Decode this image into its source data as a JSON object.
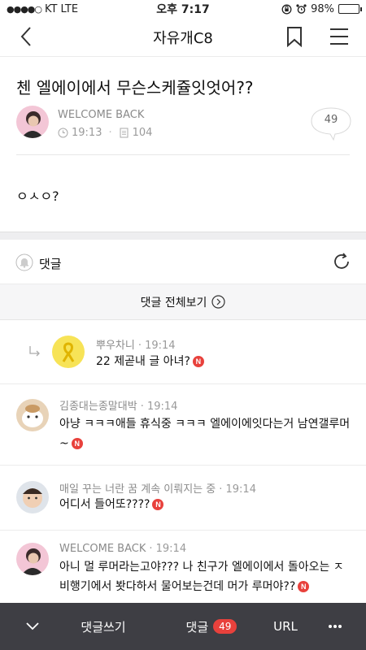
{
  "status_bar": {
    "carrier": "KT",
    "network": "LTE",
    "time": "오후 7:17",
    "battery_percent": "98%",
    "battery_level": 0.98
  },
  "nav": {
    "title": "자유개C8"
  },
  "post": {
    "title": "첸 엘에이에서 무슨스케쥴잇엇어??",
    "author": "WELCOME BACK",
    "time": "19:13",
    "views": "104",
    "reply_count": "49",
    "body": "ㅇㅅㅇ?"
  },
  "comments_section": {
    "label": "댓글",
    "view_all_label": "댓글 전체보기"
  },
  "comments": [
    {
      "author": "뿌우차니",
      "time": "· 19:14",
      "text": "22 제곧내 글 아녀?",
      "is_reply": true
    },
    {
      "author": "김종대는종말대박",
      "time": "· 19:14",
      "text": "아냥 ㅋㅋㅋ애들 휴식중 ㅋㅋㅋ 엘에이에잇다는거 남연갤루머~",
      "is_reply": false
    },
    {
      "author": "매일 꾸는 너란 꿈 계속 이뤄지는 중",
      "time": "· 19:14",
      "text": "어디서 들어또????",
      "is_reply": false
    },
    {
      "author": "WELCOME BACK",
      "time": "· 19:14",
      "text": "아니 멀 루머라는고야??? 나 친구가 엘에이에서 돌아오는 ㅈ비행기에서 봣다하서 물어보는건데 머가 루머야??",
      "is_reply": false
    }
  ],
  "new_badge": "N",
  "bottom_bar": {
    "write_label": "댓글쓰기",
    "comments_label": "댓글",
    "comments_count": "49",
    "url_label": "URL"
  },
  "colors": {
    "accent_red": "#e8413c",
    "bottom_bar_bg": "#3e3e44",
    "battery_green": "#22c23b"
  }
}
